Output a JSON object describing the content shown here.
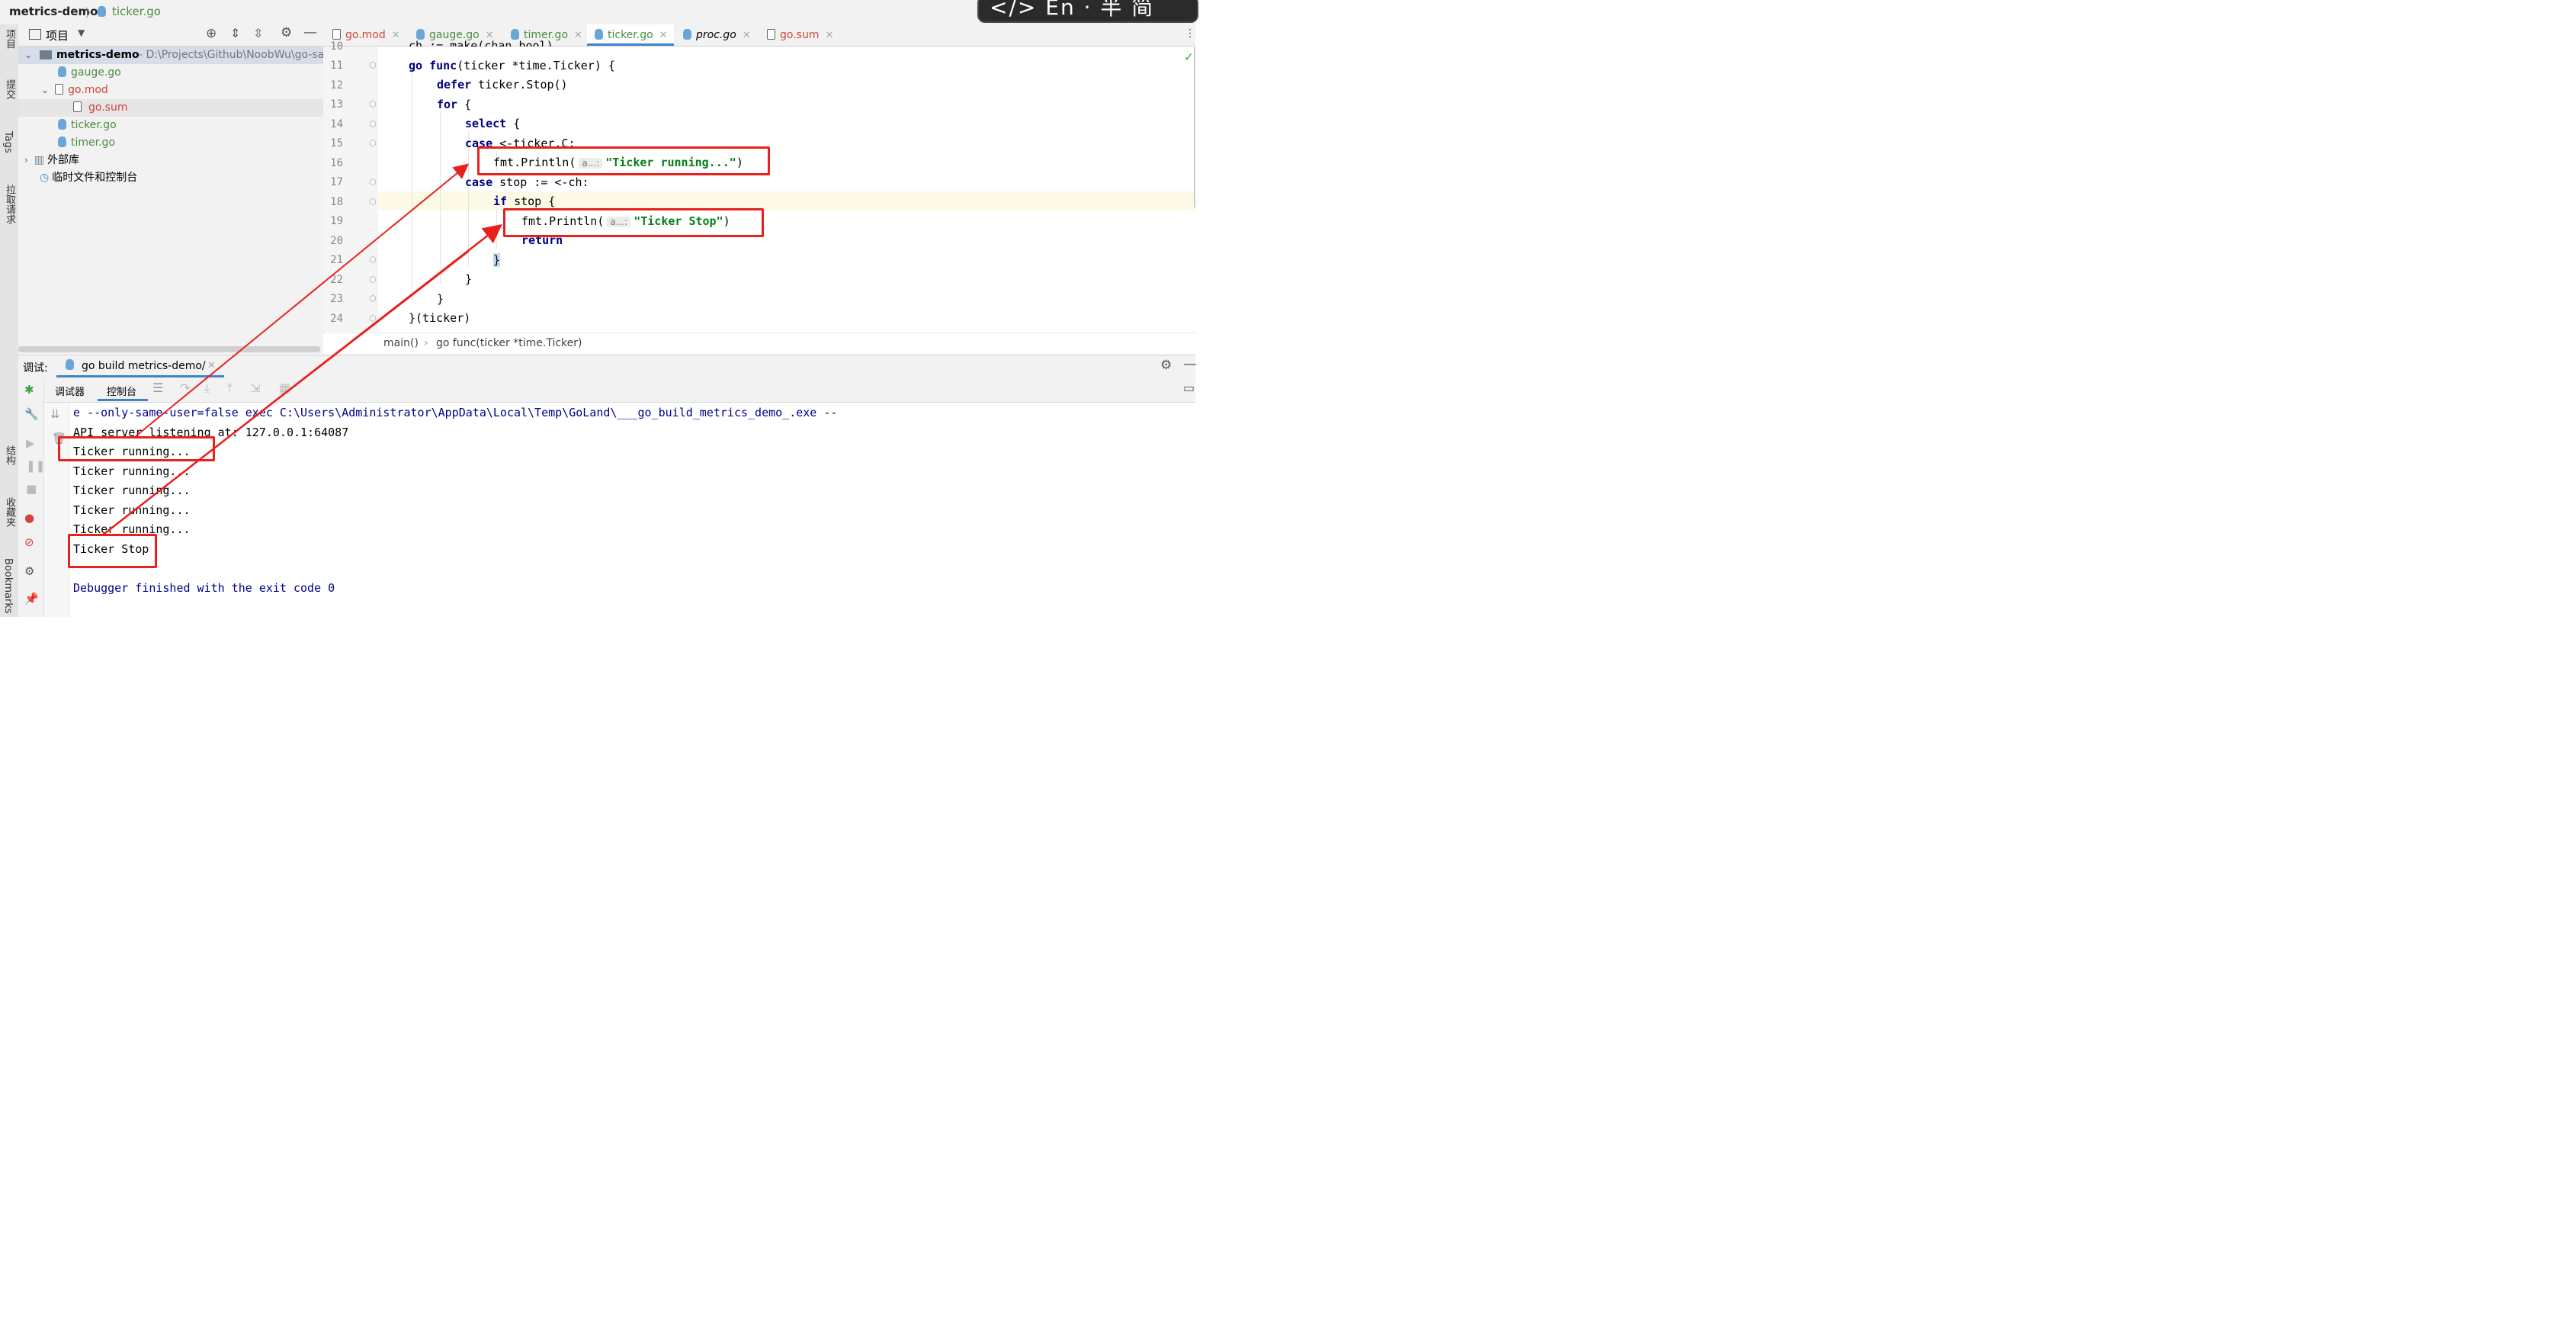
{
  "title_bar": {
    "project": "metrics-demo",
    "file": "ticker.go",
    "ime_text": "</> En · 半 简"
  },
  "left_strip": [
    "项目",
    "提交",
    "Tags",
    "拉取请求",
    "结构",
    "收藏夹",
    "Bookmarks"
  ],
  "project_panel": {
    "header": "项目",
    "root": {
      "name": "metrics-demo",
      "path": "- D:\\Projects\\Github\\NoobWu\\go-sa"
    },
    "items": [
      {
        "label": "gauge.go",
        "color": "#4a8c3f"
      },
      {
        "label": "go.mod",
        "color": "#d0443a"
      },
      {
        "label": "go.sum",
        "color": "#d0443a"
      },
      {
        "label": "ticker.go",
        "color": "#4a8c3f"
      },
      {
        "label": "timer.go",
        "color": "#4a8c3f"
      },
      {
        "label": "外部库",
        "color": "#000000"
      },
      {
        "label": "临时文件和控制台",
        "color": "#000000"
      }
    ]
  },
  "editor_tabs": [
    {
      "label": "go.mod",
      "color": "#d0443a"
    },
    {
      "label": "gauge.go",
      "color": "#4a8c3f"
    },
    {
      "label": "timer.go",
      "color": "#4a8c3f"
    },
    {
      "label": "ticker.go",
      "color": "#4a8c3f"
    },
    {
      "label": "proc.go",
      "color": "#000000"
    },
    {
      "label": "go.sum",
      "color": "#d0443a"
    }
  ],
  "code": {
    "line_numbers": [
      "10",
      "11",
      "12",
      "13",
      "14",
      "15",
      "16",
      "17",
      "18",
      "19",
      "20",
      "21",
      "22",
      "23",
      "24"
    ],
    "l10": "ch := make(chan bool)",
    "l11_kw1": "go",
    "l11_kw2": "func",
    "l11_rest": "(ticker *time.Ticker) {",
    "l12_kw": "defer",
    "l12_rest": " ticker.Stop()",
    "l13_kw": "for",
    "l13_rest": " {",
    "l14_kw": "select",
    "l14_rest": " {",
    "l15_kw": "case",
    "l15_rest": " <-ticker.C:",
    "l16_pre": "fmt.Println(",
    "l16_hint": "a...:",
    "l16_str": "\"Ticker running...\"",
    "l16_post": ")",
    "l17_kw": "case",
    "l17_rest": " stop := <-ch:",
    "l18_kw": "if",
    "l18_rest": " stop {",
    "l19_pre": "fmt.Println(",
    "l19_hint": "a...:",
    "l19_str": "\"Ticker Stop\"",
    "l19_post": ")",
    "l20_kw": "return",
    "l21": "}",
    "l22": "}",
    "l23": "}",
    "l24": "}(ticker)"
  },
  "breadcrumb": [
    "main()",
    "go func(ticker *time.Ticker)"
  ],
  "debug": {
    "label": "调试:",
    "run_tab": "go build metrics-demo/",
    "tab_debugger": "调试器",
    "tab_console": "控制台"
  },
  "console": {
    "cmd": "e --only-same-user=false exec C:\\Users\\Administrator\\AppData\\Local\\Temp\\GoLand\\___go_build_metrics_demo_.exe --",
    "api": "API server listening at: 127.0.0.1:64087",
    "running1": "Ticker running...",
    "running2": "Ticker running...",
    "running3": "Ticker running...",
    "running4": "Ticker running...",
    "running5": "Ticker running...",
    "stop": "Ticker Stop",
    "finished": "Debugger finished with the exit code 0"
  }
}
